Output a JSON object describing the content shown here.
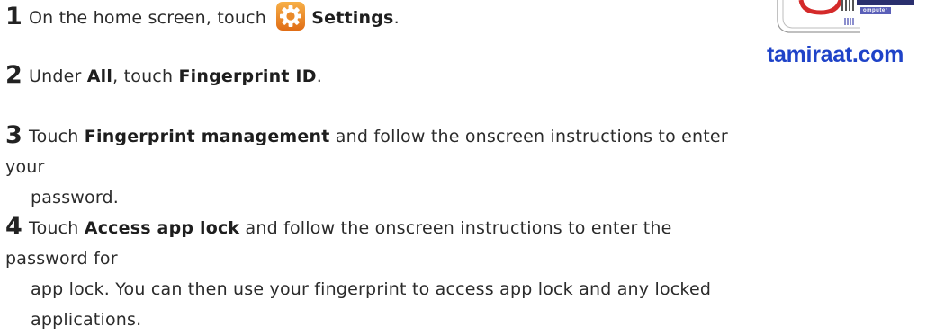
{
  "steps": [
    {
      "number": "1",
      "text_before": "On the home screen, touch",
      "bold_1": "Settings",
      "text_after": "."
    },
    {
      "number": "2",
      "text_before": "Under",
      "bold_1": "All",
      "text_middle": ", touch",
      "bold_2": "Fingerprint ID",
      "text_after": "."
    },
    {
      "number": "3",
      "text_before": "Touch",
      "bold_1": "Fingerprint management",
      "text_line1": "and follow the onscreen instructions to enter your",
      "text_line2": "password."
    },
    {
      "number": "4",
      "text_before": "Touch",
      "bold_1": "Access app lock",
      "text_line1": "and follow the onscreen instructions to enter the password for",
      "text_line2": "app lock. You can then use your fingerprint to access app lock and any locked",
      "text_line3": "applications."
    }
  ],
  "watermark": {
    "text": "tamiraat.com",
    "badge": "omputer",
    "text_color": "#1f43c8"
  },
  "icons": {
    "settings": "settings-gear-icon"
  }
}
